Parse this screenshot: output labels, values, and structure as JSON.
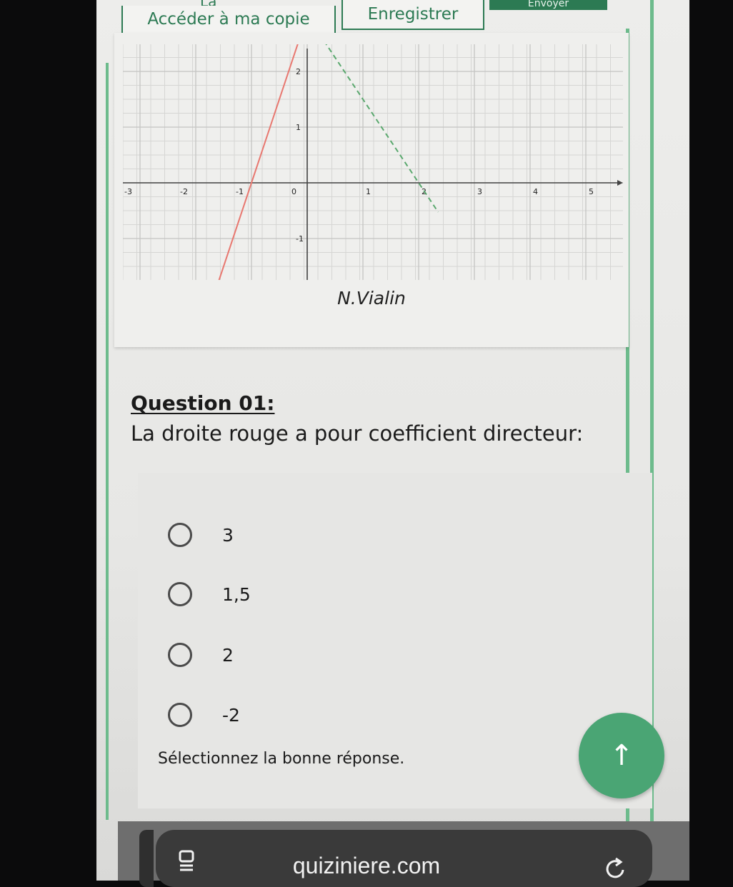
{
  "toolbar": {
    "top_fragment": "La",
    "access_label": "Accéder à ma copie",
    "save_label": "Enregistrer",
    "send_label": "Envoyer"
  },
  "figure": {
    "author": "N.Vialin",
    "x_ticks": [
      "-3",
      "-2",
      "-1",
      "0",
      "1",
      "2",
      "3",
      "4",
      "5"
    ],
    "y_ticks": [
      "2",
      "1",
      "-1"
    ]
  },
  "question": {
    "title": "Question  01:",
    "text": "La droite rouge a pour coefficient directeur:",
    "options": [
      "3",
      "1,5",
      "2",
      "-2"
    ],
    "hint": "Sélectionnez la bonne réponse."
  },
  "colors": {
    "accent_green": "#2c7a53",
    "fab_green": "#4aa574",
    "red_line": "#e8776f",
    "green_dashed_line": "#5aa86e"
  },
  "icons": {
    "fab": "arrow-up-icon",
    "tabs": "tabs-icon",
    "reload": "reload-icon"
  },
  "browser": {
    "url": "quiziniere.com"
  }
}
